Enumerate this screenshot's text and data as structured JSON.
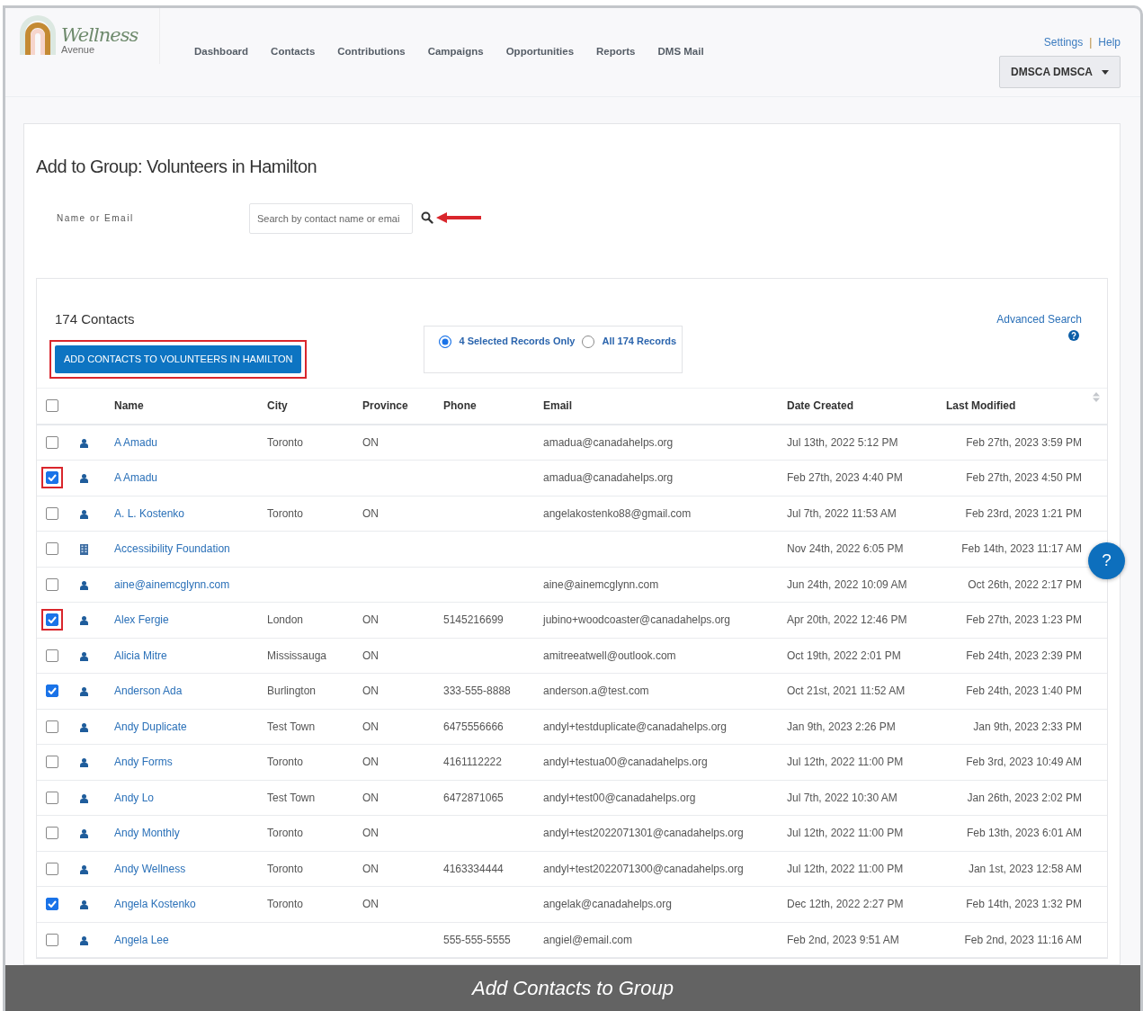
{
  "logo": {
    "title": "Wellness",
    "subtitle": "Avenue"
  },
  "nav": [
    "Dashboard",
    "Contacts",
    "Contributions",
    "Campaigns",
    "Opportunities",
    "Reports",
    "DMS Mail"
  ],
  "top_links": {
    "items": [
      "Settings",
      "Help"
    ],
    "separator": "|"
  },
  "user_menu": {
    "label": "DMSCA DMSCA"
  },
  "page_title": "Add to Group: Volunteers in Hamilton",
  "search": {
    "label": "Name or Email",
    "placeholder": "Search by contact name or emai",
    "annotated": true
  },
  "results": {
    "count": "174 Contacts",
    "add_button": {
      "label": "ADD CONTACTS TO VOLUNTEERS IN HAMILTON",
      "highlighted": true
    },
    "scope": [
      {
        "label": "4 Selected Records Only",
        "selected": true
      },
      {
        "label": "All 174 Records",
        "selected": false
      }
    ],
    "advanced_search": "Advanced Search"
  },
  "table": {
    "select_all": {
      "checked": false
    },
    "columns": [
      "Name",
      "City",
      "Province",
      "Phone",
      "Email",
      "Date Created",
      "Last Modified"
    ],
    "rows": [
      {
        "kind": "person",
        "checked": false,
        "highlighted": false,
        "name": "A Amadu",
        "city": "Toronto",
        "province": "ON",
        "phone": "",
        "email": "amadua@canadahelps.org",
        "created": "Jul 13th, 2022 5:12 PM",
        "modified": "Feb 27th, 2023 3:59 PM"
      },
      {
        "kind": "person",
        "checked": true,
        "highlighted": true,
        "name": "A Amadu",
        "city": "",
        "province": "",
        "phone": "",
        "email": "amadua@canadahelps.org",
        "created": "Feb 27th, 2023 4:40 PM",
        "modified": "Feb 27th, 2023 4:50 PM"
      },
      {
        "kind": "person",
        "checked": false,
        "highlighted": false,
        "name": "A. L. Kostenko",
        "city": "Toronto",
        "province": "ON",
        "phone": "",
        "email": "angelakostenko88@gmail.com",
        "created": "Jul 7th, 2022 11:53 AM",
        "modified": "Feb 23rd, 2023 1:21 PM"
      },
      {
        "kind": "organization",
        "checked": false,
        "highlighted": false,
        "name": "Accessibility Foundation",
        "city": "",
        "province": "",
        "phone": "",
        "email": "",
        "created": "Nov 24th, 2022 6:05 PM",
        "modified": "Feb 14th, 2023 11:17 AM"
      },
      {
        "kind": "person",
        "checked": false,
        "highlighted": false,
        "name": "aine@ainemcglynn.com",
        "city": "",
        "province": "",
        "phone": "",
        "email": "aine@ainemcglynn.com",
        "created": "Jun 24th, 2022 10:09 AM",
        "modified": "Oct 26th, 2022 2:17 PM"
      },
      {
        "kind": "person",
        "checked": true,
        "highlighted": true,
        "name": "Alex Fergie",
        "city": "London",
        "province": "ON",
        "phone": "5145216699",
        "email": "jubino+woodcoaster@canadahelps.org",
        "created": "Apr 20th, 2022 12:46 PM",
        "modified": "Feb 27th, 2023 1:23 PM"
      },
      {
        "kind": "person",
        "checked": false,
        "highlighted": false,
        "name": "Alicia Mitre",
        "city": "Mississauga",
        "province": "ON",
        "phone": "",
        "email": "amitreeatwell@outlook.com",
        "created": "Oct 19th, 2022 2:01 PM",
        "modified": "Feb 24th, 2023 2:39 PM"
      },
      {
        "kind": "person",
        "checked": true,
        "highlighted": false,
        "name": "Anderson Ada",
        "city": "Burlington",
        "province": "ON",
        "phone": "333-555-8888",
        "email": "anderson.a@test.com",
        "created": "Oct 21st, 2021 11:52 AM",
        "modified": "Feb 24th, 2023 1:40 PM"
      },
      {
        "kind": "person",
        "checked": false,
        "highlighted": false,
        "name": "Andy Duplicate",
        "city": "Test Town",
        "province": "ON",
        "phone": "6475556666",
        "email": "andyl+testduplicate@canadahelps.org",
        "created": "Jan 9th, 2023 2:26 PM",
        "modified": "Jan 9th, 2023 2:33 PM"
      },
      {
        "kind": "person",
        "checked": false,
        "highlighted": false,
        "name": "Andy Forms",
        "city": "Toronto",
        "province": "ON",
        "phone": "4161112222",
        "email": "andyl+testua00@canadahelps.org",
        "created": "Jul 12th, 2022 11:00 PM",
        "modified": "Feb 3rd, 2023 10:49 AM"
      },
      {
        "kind": "person",
        "checked": false,
        "highlighted": false,
        "name": "Andy Lo",
        "city": "Test Town",
        "province": "ON",
        "phone": "6472871065",
        "email": "andyl+test00@canadahelps.org",
        "created": "Jul 7th, 2022 10:30 AM",
        "modified": "Jan 26th, 2023 2:02 PM"
      },
      {
        "kind": "person",
        "checked": false,
        "highlighted": false,
        "name": "Andy Monthly",
        "city": "Toronto",
        "province": "ON",
        "phone": "",
        "email": "andyl+test2022071301@canadahelps.org",
        "created": "Jul 12th, 2022 11:00 PM",
        "modified": "Feb 13th, 2023 6:01 AM"
      },
      {
        "kind": "person",
        "checked": false,
        "highlighted": false,
        "name": "Andy Wellness",
        "city": "Toronto",
        "province": "ON",
        "phone": "4163334444",
        "email": "andyl+test2022071300@canadahelps.org",
        "created": "Jul 12th, 2022 11:00 PM",
        "modified": "Jan 1st, 2023 12:58 AM"
      },
      {
        "kind": "person",
        "checked": true,
        "highlighted": false,
        "name": "Angela Kostenko",
        "city": "Toronto",
        "province": "ON",
        "phone": "",
        "email": "angelak@canadahelps.org",
        "created": "Dec 12th, 2022 2:27 PM",
        "modified": "Feb 14th, 2023 1:32 PM"
      },
      {
        "kind": "person",
        "checked": false,
        "highlighted": false,
        "name": "Angela Lee",
        "city": "",
        "province": "",
        "phone": "555-555-5555",
        "email": "angiel@email.com",
        "created": "Feb 2nd, 2023 9:51 AM",
        "modified": "Feb 2nd, 2023 11:16 AM"
      }
    ]
  },
  "help_bubble": "?",
  "caption": "Add Contacts to Group"
}
